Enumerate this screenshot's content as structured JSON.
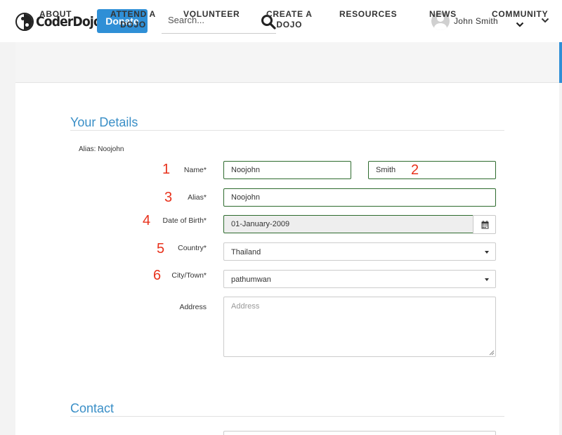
{
  "header": {
    "logo_text": "CoderDojo",
    "donate_label": "Donate",
    "search_placeholder": "Search...",
    "user_name": "John Smith"
  },
  "nav": {
    "items": [
      {
        "line1": "ABOUT",
        "line2": ""
      },
      {
        "line1": "ATTEND A",
        "line2": "DOJO"
      },
      {
        "line1": "VOLUNTEER",
        "line2": ""
      },
      {
        "line1": "CREATE A",
        "line2": "DOJO"
      },
      {
        "line1": "RESOURCES",
        "line2": ""
      },
      {
        "line1": "NEWS",
        "line2": ""
      },
      {
        "line1": "COMMUNITY",
        "line2": ""
      }
    ]
  },
  "details": {
    "title": "Your Details",
    "alias_note": "Alias: Noojohn",
    "name_label": "Name*",
    "first_name": "Noojohn",
    "last_name": "Smith",
    "alias_label": "Alias*",
    "alias_value": "Noojohn",
    "dob_label": "Date of Birth*",
    "dob_value": "01-January-2009",
    "country_label": "Country*",
    "country_value": "Thailand",
    "city_label": "City/Town*",
    "city_value": "pathumwan",
    "address_label": "Address",
    "address_placeholder": "Address"
  },
  "contact": {
    "title": "Contact"
  },
  "markers": [
    "1",
    "2",
    "3",
    "4",
    "5",
    "6"
  ],
  "colors": {
    "accent": "#2f8fd6",
    "section_title": "#3a8fc7",
    "marker": "#e8321c",
    "valid_border": "#2e6b2e"
  }
}
